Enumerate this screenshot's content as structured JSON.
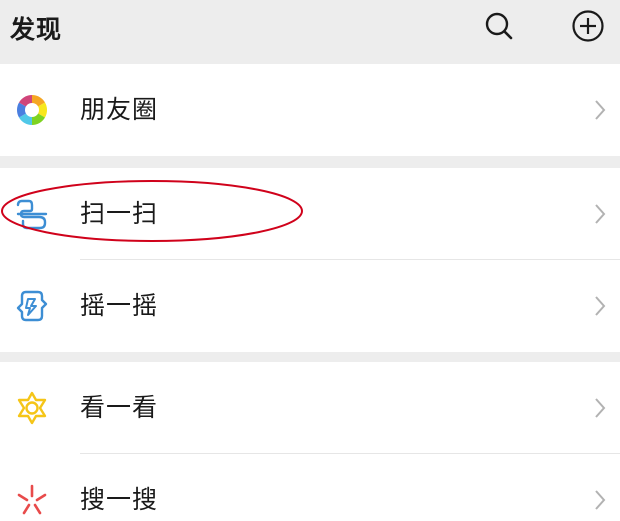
{
  "header": {
    "title": "发现",
    "search_icon": "search-icon",
    "add_icon": "plus-circle-icon"
  },
  "groups": [
    {
      "items": [
        {
          "label": "朋友圈",
          "icon": "moments-icon",
          "chevron": "chevron-right-icon"
        }
      ]
    },
    {
      "items": [
        {
          "label": "扫一扫",
          "icon": "scan-icon",
          "chevron": "chevron-right-icon"
        },
        {
          "label": "摇一摇",
          "icon": "shake-icon",
          "chevron": "chevron-right-icon"
        }
      ]
    },
    {
      "items": [
        {
          "label": "看一看",
          "icon": "top-stories-icon",
          "chevron": "chevron-right-icon"
        },
        {
          "label": "搜一搜",
          "icon": "search-feature-icon",
          "chevron": "chevron-right-icon"
        }
      ]
    }
  ],
  "annotation": {
    "color": "#d0021b",
    "target": "扫一扫"
  },
  "colors": {
    "background": "#ededed",
    "card": "#ffffff",
    "text": "#1a1a1a",
    "chevron": "#b2b2b2",
    "scan_blue": "#3d8ed4",
    "star_yellow": "#f5c518",
    "search_red": "#e84b4b"
  }
}
